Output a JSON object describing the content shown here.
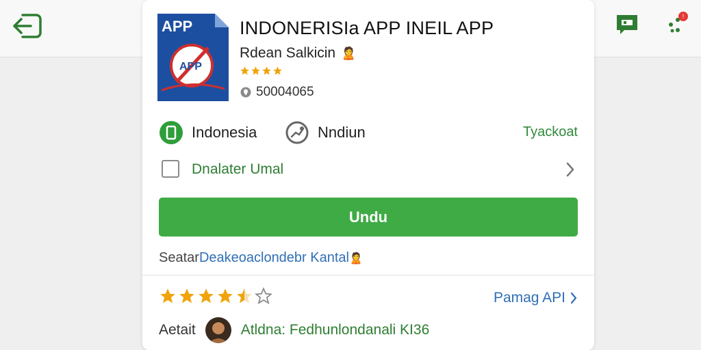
{
  "colors": {
    "accent_green": "#3fab45",
    "link_blue": "#2f6fb5",
    "star_gold": "#f0a30a",
    "app_icon_blue": "#1d4fa0"
  },
  "topbar": {
    "back_icon": "back-arrow-icon",
    "chat_icon": "chat-icon",
    "notifications_icon": "apps-notification-icon"
  },
  "app": {
    "icon_text": "APP",
    "icon_inner_text": "APP",
    "title": "INDONERISIa APP INEIL APP",
    "developer": "Rdean Salkicin",
    "developer_emoji": "🙎",
    "mini_rating": 4,
    "id_number": "50004065"
  },
  "meta": {
    "country": "Indonesia",
    "language": "Nndiun",
    "link": "Tyackoat"
  },
  "option": {
    "label": "Dnalater Umal"
  },
  "download": {
    "label": "Undu"
  },
  "note": {
    "prefix": "Seatar ",
    "link": "Deakeoaclondebr Kantal",
    "emoji": "🙎"
  },
  "rating": {
    "value": 4.5,
    "max": 6
  },
  "reviews": {
    "label": "Pamag API"
  },
  "author": {
    "label": "Aetait",
    "name": "Atldna: Fedhunlondanali KI36"
  }
}
